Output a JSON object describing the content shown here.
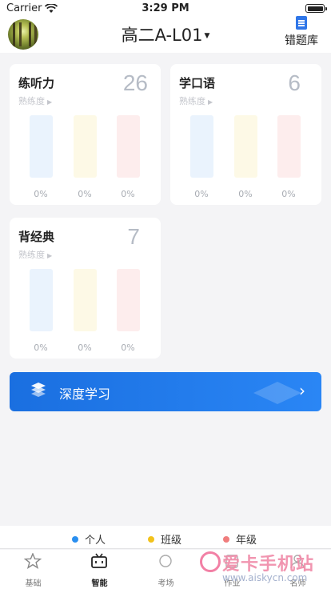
{
  "status_bar": {
    "carrier": "Carrier",
    "time": "3:29 PM"
  },
  "header": {
    "class_name": "高二A-L01",
    "mistake_label": "错题库"
  },
  "cards": [
    {
      "title": "练听力",
      "count": "26",
      "proficiency": "熟练度",
      "percents": [
        "0%",
        "0%",
        "0%"
      ]
    },
    {
      "title": "学口语",
      "count": "6",
      "proficiency": "熟练度",
      "percents": [
        "0%",
        "0%",
        "0%"
      ]
    },
    {
      "title": "背经典",
      "count": "7",
      "proficiency": "熟练度",
      "percents": [
        "0%",
        "0%",
        "0%"
      ]
    }
  ],
  "deep_learning": {
    "label": "深度学习"
  },
  "legend": [
    {
      "label": "个人",
      "color": "#2a8ff0"
    },
    {
      "label": "班级",
      "color": "#f2c21b"
    },
    {
      "label": "年级",
      "color": "#f07d7d"
    }
  ],
  "tabs": [
    {
      "label": "基础",
      "icon": "star-icon",
      "active": false
    },
    {
      "label": "智能",
      "icon": "tv-icon",
      "active": true
    },
    {
      "label": "考场",
      "icon": "exam-icon",
      "active": false
    },
    {
      "label": "作业",
      "icon": "homework-icon",
      "active": false
    },
    {
      "label": "名师",
      "icon": "teacher-icon",
      "active": false
    }
  ],
  "watermark": {
    "text": "爱卡手机站",
    "url": "www.aiskycn.com"
  }
}
